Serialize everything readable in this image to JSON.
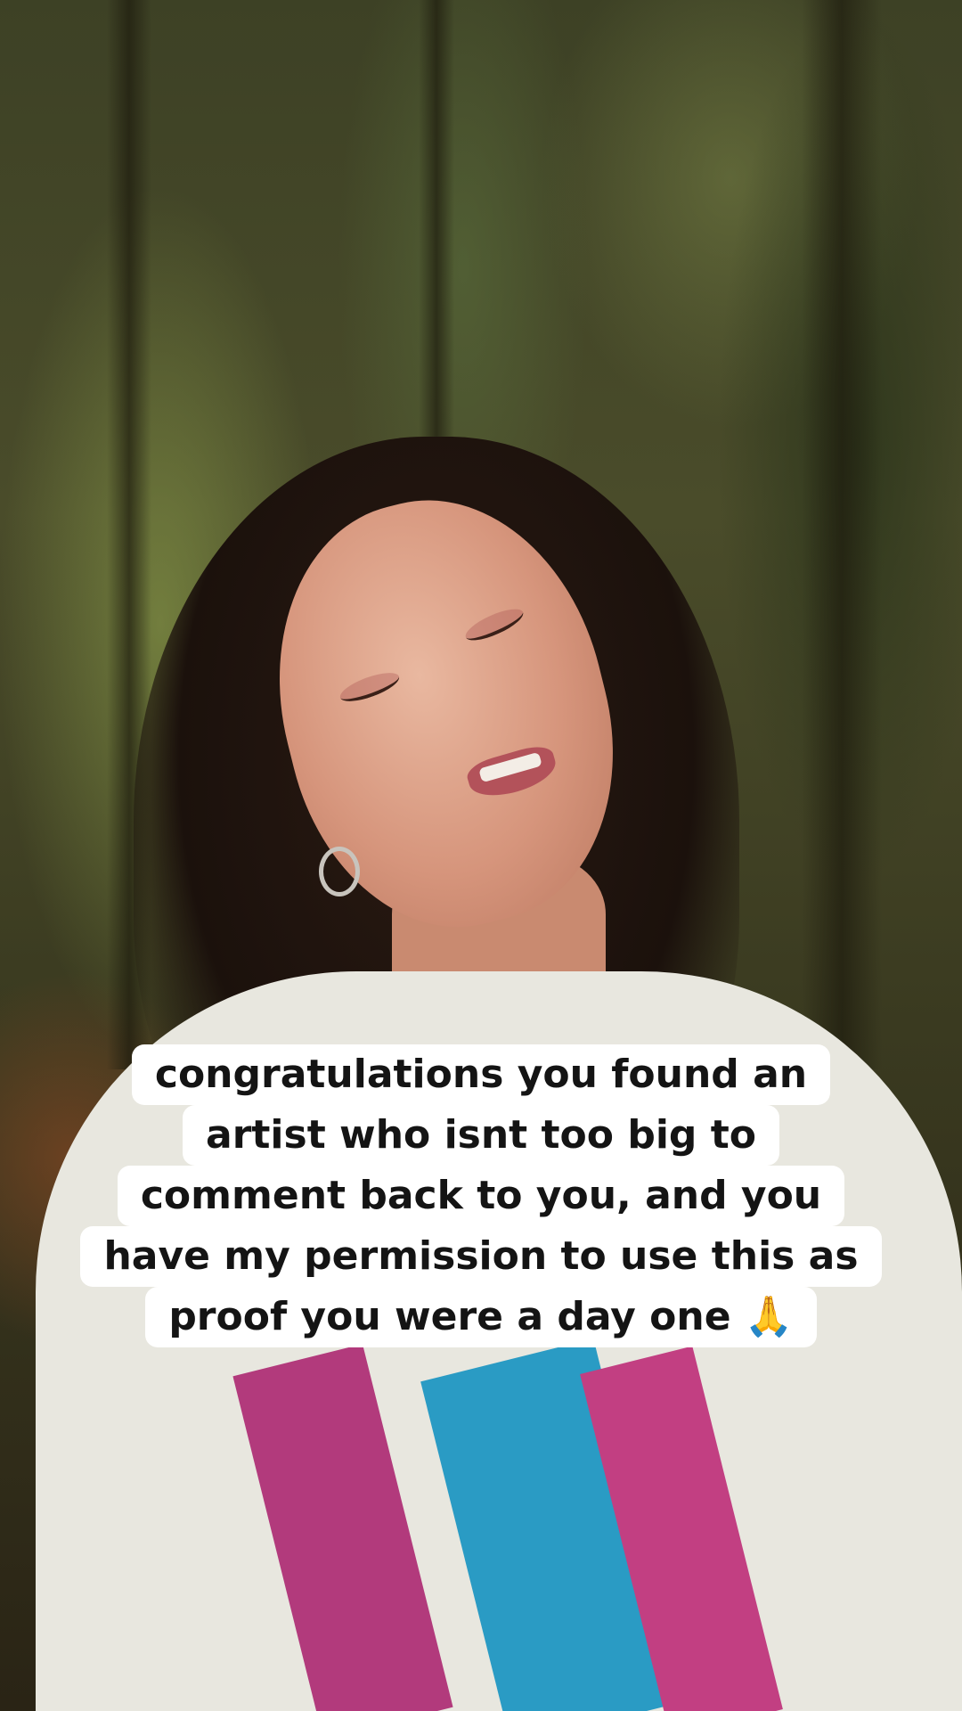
{
  "caption": {
    "lines": [
      "congratulations you found an",
      "artist who isnt too big to",
      "comment back to you, and you",
      "have my permission to use this as",
      "proof you were a day one 🙏"
    ]
  },
  "colors": {
    "caption_background": "#ffffff",
    "caption_text": "#141414",
    "shirt": "#e8e7df",
    "print_pink": "#b23a7c",
    "print_blue": "#2a9bc4"
  }
}
